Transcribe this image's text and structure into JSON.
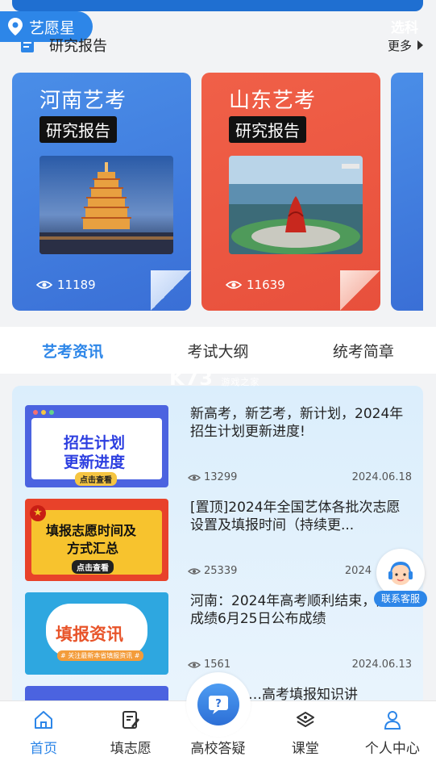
{
  "header": {
    "location": "艺愿星",
    "choose_course": "选科"
  },
  "research_section": {
    "title": "研究报告",
    "more_label": "更多"
  },
  "report_cards": [
    {
      "title": "河南艺考",
      "tag": "研究报告",
      "views": "11189"
    },
    {
      "title": "山东艺考",
      "tag": "研究报告",
      "views": "11639"
    }
  ],
  "tabs": [
    {
      "label": "艺考资讯"
    },
    {
      "label": "考试大纲"
    },
    {
      "label": "统考简章"
    }
  ],
  "watermark": {
    "text": "K73",
    "sub": "游戏之家"
  },
  "news": [
    {
      "headline": "新高考，新艺考，新计划，2024年招生计划更新进度!",
      "views": "13299",
      "date": "2024.06.18",
      "thumb": {
        "line1": "招生计划",
        "line2": "更新进度",
        "button": "点击查看"
      }
    },
    {
      "headline": "[置顶]2024年全国艺体各批次志愿设置及填报时间（持续更...",
      "views": "25339",
      "date": "2024",
      "thumb": {
        "line1": "填报志愿时间及",
        "line2": "方式汇总",
        "button": "点击查看"
      }
    },
    {
      "headline": "河南：2024年高考顺利结束，高考成绩6月25日公布成绩",
      "views": "1561",
      "date": "2024.06.13",
      "thumb": {
        "line1": "填报资讯",
        "line2": "# 关注最新本省填报资讯 #",
        "button": ""
      }
    },
    {
      "headline": "……高考填报知识讲",
      "views": "",
      "date": "",
      "thumb": {
        "line1": "",
        "line2": "",
        "button": ""
      }
    }
  ],
  "support": {
    "label": "联系客服"
  },
  "bottom_nav": [
    {
      "label": "首页",
      "icon": "home-icon"
    },
    {
      "label": "填志愿",
      "icon": "edit-form-icon"
    },
    {
      "label": "高校答疑",
      "icon": "question-chat-icon"
    },
    {
      "label": "课堂",
      "icon": "classroom-icon"
    },
    {
      "label": "个人中心",
      "icon": "user-icon"
    }
  ],
  "colors": {
    "accent": "#2d86e8",
    "card_blue": "#3a6fd6",
    "card_red": "#e8503c"
  }
}
